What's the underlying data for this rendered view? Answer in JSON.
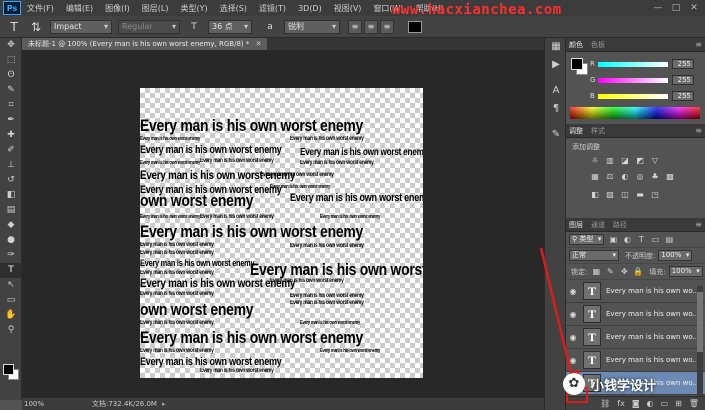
{
  "app": {
    "logo": "Ps"
  },
  "menu": [
    "文件(F)",
    "编辑(E)",
    "图像(I)",
    "图层(L)",
    "类型(Y)",
    "选择(S)",
    "滤镜(T)",
    "3D(D)",
    "视图(V)",
    "窗口(W)",
    "帮助(H)"
  ],
  "watermark_text": "www.hacxianchea.com",
  "options": {
    "font_family": "Impact",
    "font_style": "Regular",
    "font_size": "36 点",
    "anti_alias": "锐利",
    "text_color": "#000000"
  },
  "document": {
    "tab_title": "未标题-1 @ 100% (Every man is his own worst enemy, RGB/8) *",
    "canvas_text": "Every man is his own worst enemy"
  },
  "status": {
    "zoom": "100%",
    "doc_size": "文档:732.4K/26.0M"
  },
  "color_panel": {
    "tabs": [
      "颜色",
      "色板"
    ],
    "sliders": [
      {
        "label": "R",
        "value": "255"
      },
      {
        "label": "G",
        "value": "255"
      },
      {
        "label": "B",
        "value": "255"
      }
    ]
  },
  "adjust_panel": {
    "tabs": [
      "调整",
      "样式"
    ],
    "title": "添加调整"
  },
  "layers_panel": {
    "tabs": [
      "图层",
      "通道",
      "路径"
    ],
    "filter_kind": "类型",
    "blend_mode": "正常",
    "opacity_label": "不透明度:",
    "opacity_value": "100%",
    "lock_label": "锁定:",
    "fill_label": "填充:",
    "fill_value": "100%",
    "layers": [
      {
        "name": "Every man is his own wo...",
        "selected": false
      },
      {
        "name": "Every man is his own wo...",
        "selected": false
      },
      {
        "name": "Every man is his own wo...",
        "selected": false
      },
      {
        "name": "Every man is his own wo...",
        "selected": false
      },
      {
        "name": "Every man is his own wo...",
        "selected": true
      }
    ]
  },
  "brand": {
    "text": "小钱学设计"
  },
  "colors": {
    "annotation": "#e01a1a",
    "selection": "#6c8ab3",
    "watermark": "#ff2e2e"
  }
}
